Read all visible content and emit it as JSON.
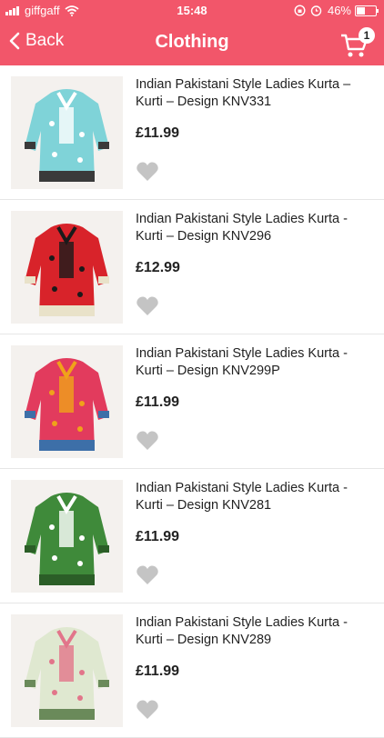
{
  "status_bar": {
    "carrier": "giffgaff",
    "time": "15:48",
    "battery": "46%",
    "battery_level": 0.46
  },
  "nav": {
    "back_label": "Back",
    "title": "Clothing",
    "cart_count": "1"
  },
  "colors": {
    "accent": "#f2566a",
    "heart": "#c4c4c4"
  },
  "products": [
    {
      "name": "Indian Pakistani Style Ladies Kurta – Kurti – Design KNV331",
      "price": "£11.99",
      "main": "#7fd3d8",
      "accent": "#ffffff",
      "trim": "#3a3a3a"
    },
    {
      "name": "Indian Pakistani Style Ladies Kurta - Kurti – Design KNV296",
      "price": "£12.99",
      "main": "#d8232a",
      "accent": "#1a1a1a",
      "trim": "#e9e2c9"
    },
    {
      "name": "Indian Pakistani Style Ladies Kurta - Kurti – Design KNV299P",
      "price": "£11.99",
      "main": "#e23b5d",
      "accent": "#f0a21a",
      "trim": "#3d6fa8"
    },
    {
      "name": "Indian Pakistani Style Ladies Kurta - Kurti – Design KNV281",
      "price": "£11.99",
      "main": "#3f8a3a",
      "accent": "#ffffff",
      "trim": "#2b5e27"
    },
    {
      "name": "Indian Pakistani Style Ladies Kurta - Kurti – Design KNV289",
      "price": "£11.99",
      "main": "#dfe8d0",
      "accent": "#e2758a",
      "trim": "#6a8a5a"
    }
  ]
}
